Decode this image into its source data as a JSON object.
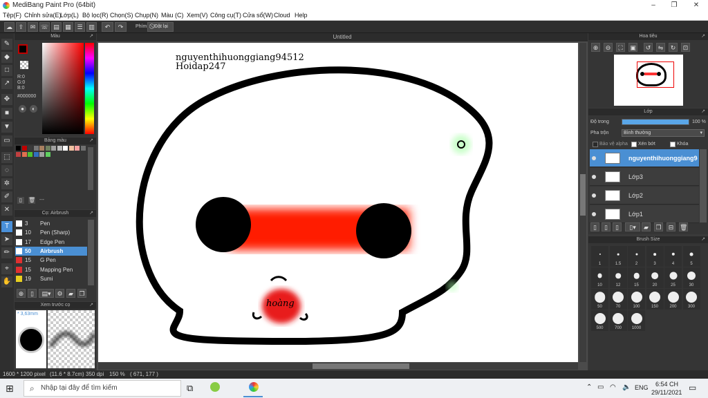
{
  "window": {
    "title": "MediBang Paint Pro (64bit)",
    "min": "–",
    "max": "❐",
    "close": "✕"
  },
  "menu": [
    "Tệp(F)",
    "Chỉnh sửa(E)",
    "Lớp(L)",
    "Bộ lọc(R)",
    "Chọn(S)",
    "Chụp(N)",
    "Màu (C)",
    "Xem(V)",
    "Công cụ(T)",
    "Cửa sổ(W)",
    "Cloud",
    "Help"
  ],
  "toolbar": {
    "key_label": "Phím",
    "reset_label": "Đặt lại"
  },
  "color_panel": {
    "title": "Màu",
    "r": "R:0",
    "g": "G:0",
    "b": "B:0",
    "hex": "#000000",
    "fg_color": "#000000",
    "accent": "#c00000"
  },
  "palette_panel": {
    "title": "Bảng màu",
    "dash": "---",
    "swatches": [
      "#000000",
      "#c00000",
      "#3a3a3a",
      "#777777",
      "#a88060",
      "#708060",
      "#a0a0a0",
      "#c0c0c0",
      "#ffffff",
      "#f0c0a0",
      "#f4a0a0",
      "#707070",
      "#c04040",
      "#e07050",
      "#50c030",
      "#3070c0",
      "#a0a0a0",
      "#60d060"
    ]
  },
  "brush_panel": {
    "title": "Cọ: Airbrush",
    "brushes": [
      {
        "size": "3",
        "name": "Pen",
        "color": "#ffffff"
      },
      {
        "size": "10",
        "name": "Pen (Sharp)",
        "color": "#ffffff"
      },
      {
        "size": "17",
        "name": "Edge Pen",
        "color": "#ffffff"
      },
      {
        "size": "50",
        "name": "Airbrush",
        "color": "#ffffff"
      },
      {
        "size": "15",
        "name": "G Pen",
        "color": "#e03030"
      },
      {
        "size": "15",
        "name": "Mapping Pen",
        "color": "#e03030"
      },
      {
        "size": "19",
        "name": "Sumi",
        "color": "#e8d020"
      }
    ]
  },
  "preview_panel": {
    "title": "Xem trước cọ",
    "size": "* 3,63mm"
  },
  "canvas": {
    "tab": "Untitled",
    "text_line1": "nguyenthihuonggiang94512",
    "text_line2": "Hoidap247",
    "mouth_text": "hoàng"
  },
  "navigator": {
    "title": "Hoa tiêu"
  },
  "layer_panel": {
    "title": "Lớp",
    "opacity_label": "Độ trong",
    "opacity_value": "100 %",
    "opacity": 1.0,
    "blend_label": "Pha trộn",
    "blend_value": "Bình thường",
    "protect_alpha": "Bảo vệ alpha",
    "clipping": "Xén bớt",
    "lock": "Khóa",
    "layers": [
      {
        "name": "nguyenthihuonggiang94512",
        "selected": true
      },
      {
        "name": "Lớp3",
        "selected": false
      },
      {
        "name": "Lớp2",
        "selected": false
      },
      {
        "name": "Lớp1",
        "selected": false
      }
    ]
  },
  "brush_size_panel": {
    "title": "Brush Size",
    "sizes": [
      "1",
      "1.5",
      "2",
      "3",
      "4",
      "5",
      "10",
      "12",
      "15",
      "20",
      "25",
      "30",
      "50",
      "70",
      "100",
      "150",
      "200",
      "300",
      "500",
      "700",
      "1000"
    ]
  },
  "status": {
    "size": "1600 * 1200 pixel",
    "cm": "(11.6 * 8.7cm)",
    "dpi": "350 dpi",
    "zoom": "150 %",
    "coords": "( 671, 177 )"
  },
  "taskbar": {
    "search": "Nhập tại đây để tìm kiếm",
    "lang": "ENG",
    "time": "6:54 CH",
    "date": "29/11/2021"
  }
}
